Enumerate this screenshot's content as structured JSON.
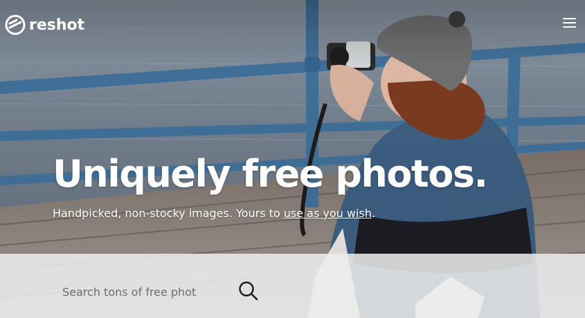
{
  "header": {
    "logo_text": "reshot",
    "logo_icon": "reshot-logo-icon",
    "menu_icon": "hamburger-menu-icon"
  },
  "hero": {
    "headline": "Uniquely free photos.",
    "subline_prefix": "Handpicked, non-stocky images. Yours to ",
    "subline_link": "use as you wish",
    "subline_suffix": "."
  },
  "search": {
    "placeholder": "Search tons of free phot",
    "icon": "search-icon"
  },
  "colors": {
    "text": "#ffffff",
    "railing": "#3f6f98",
    "search_band": "#eeeeee"
  }
}
